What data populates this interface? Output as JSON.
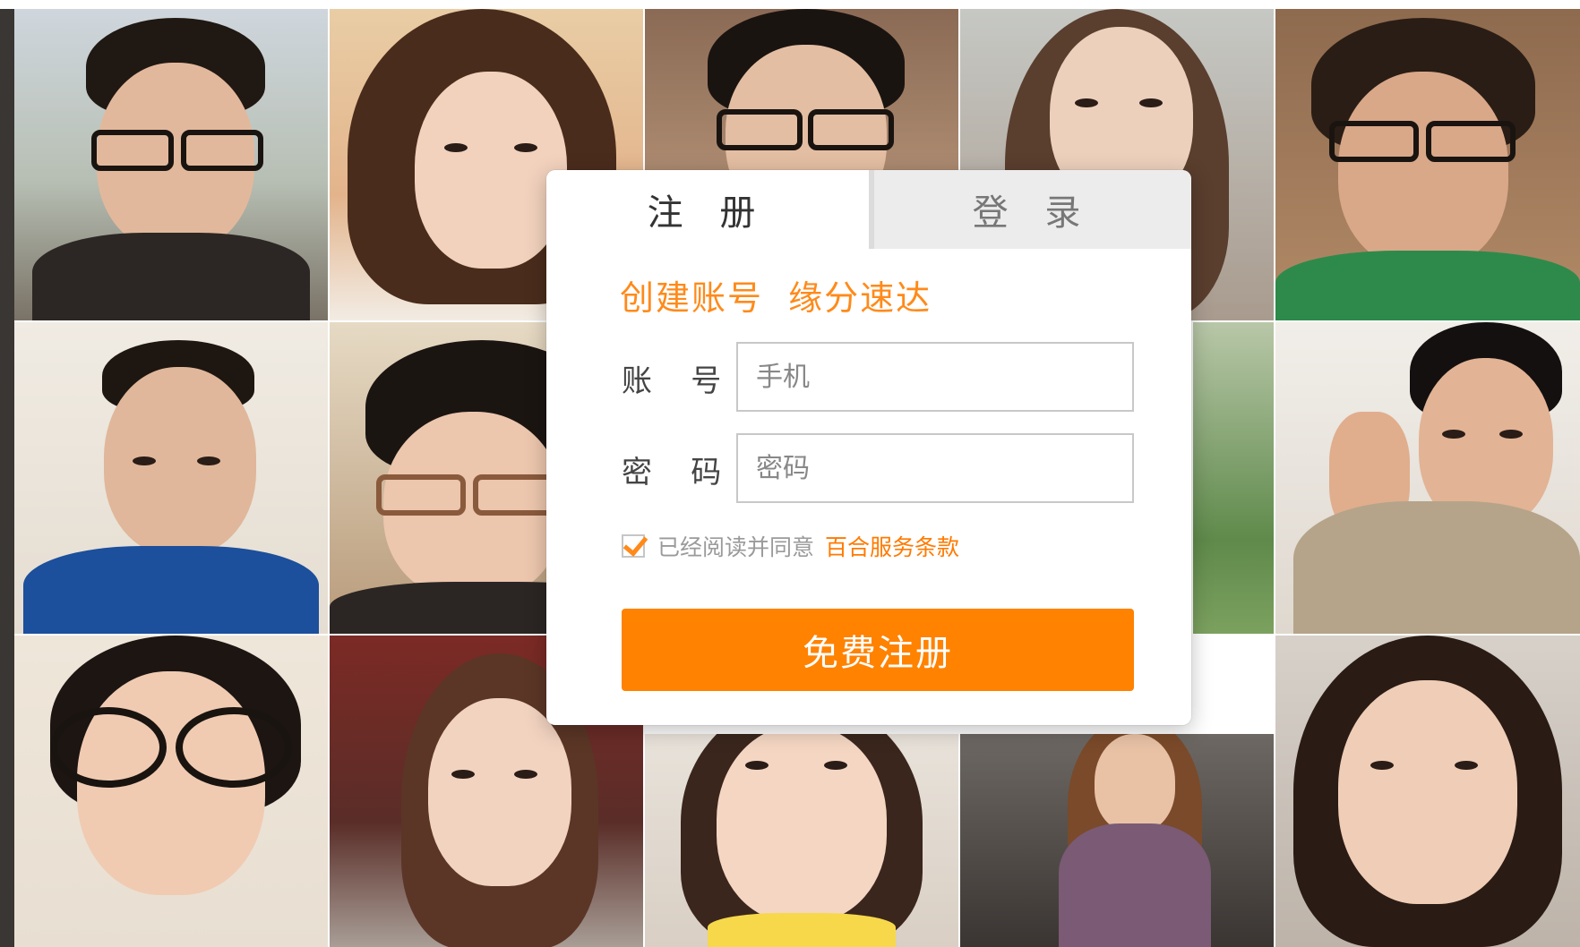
{
  "tabs": {
    "register": "注 册",
    "login": "登 录"
  },
  "slogan": "创建账号  缘分速达",
  "account": {
    "label": "账    号",
    "placeholder": "手机"
  },
  "password": {
    "label": "密    码",
    "placeholder": "密码"
  },
  "agreement": {
    "checked": true,
    "text": "已经阅读并同意",
    "link": "百合服务条款"
  },
  "submit_label": "免费注册",
  "colors": {
    "accent": "#ff8200",
    "slogan": "#ff8a1a",
    "inactive_tab": "#ececec"
  },
  "background_photos": [
    {
      "name": "photo-man-glasses-scarf"
    },
    {
      "name": "photo-woman-sunglasses-on-head"
    },
    {
      "name": "photo-man-glasses-indoor"
    },
    {
      "name": "photo-woman-long-hair"
    },
    {
      "name": "photo-man-glasses-green-shirt"
    },
    {
      "name": "photo-man-blue-shirt"
    },
    {
      "name": "photo-man-leopard-glasses"
    },
    {
      "name": "photo-woman-outdoor-partial"
    },
    {
      "name": "photo-man-salute"
    },
    {
      "name": "photo-woman-round-glasses"
    },
    {
      "name": "photo-woman-in-car"
    },
    {
      "name": "photo-woman-yellow-top"
    },
    {
      "name": "photo-woman-purple-tee"
    },
    {
      "name": "photo-woman-white-top"
    }
  ]
}
